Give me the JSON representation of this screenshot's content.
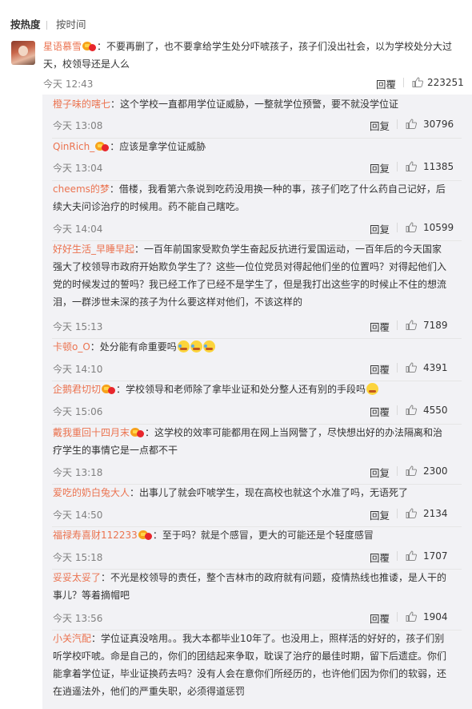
{
  "sort": {
    "hot_label": "按热度",
    "time_label": "按时间"
  },
  "top_comment": {
    "username": "星语慕雪",
    "text": "：不要再删了，也不要拿给学生处分吓唬孩子，孩子们没出社会，以为学校处分大过天，校领导还是人么",
    "time": "今天 12:43",
    "reply_label": "回覆",
    "likes": "223251"
  },
  "replies": [
    {
      "username": "橙子味的嗐七",
      "vip": false,
      "text": "：这个学校一直都用学位证威胁，一整就学位预警，要不就没学位证",
      "time": "今天 13:08",
      "reply_label": "回复",
      "likes": "30796"
    },
    {
      "username": "QinRich_",
      "vip": true,
      "text": "：应该是拿学位证威胁",
      "time": "今天 13:04",
      "reply_label": "回复",
      "likes": "11385"
    },
    {
      "username": "cheems的梦",
      "vip": false,
      "text": "：借楼，我看第六条说到吃药没用换一种的事，孩子们吃了什么药自己记好，后续大夫问诊治疗的时候用。药不能自己瞎吃。",
      "time": "今天 14:04",
      "reply_label": "回复",
      "likes": "10599"
    },
    {
      "username": "好好生活_早睡早起",
      "vip": false,
      "text": "：一百年前国家受欺负学生奋起反抗进行爱国运动，一百年后的今天国家强大了校领导市政府开始欺负学生了？这些一位位党员对得起他们坐的位置吗？对得起他们入党的时候发过的誓吗？我已经工作了已经不是学生了，但是我打出这些字的时候止不住的想流泪，一群涉世未深的孩子为什么要这样对他们，不该这样的",
      "time": "今天 15:13",
      "reply_label": "回覆",
      "likes": "7189"
    },
    {
      "username": "卡顿o_O",
      "vip": false,
      "text": "：处分能有命重要吗",
      "emojis": 3,
      "time": "今天 14:10",
      "reply_label": "回覆",
      "likes": "4391"
    },
    {
      "username": "企鹅君切切",
      "vip": true,
      "text": "：学校领导和老师除了拿毕业证和处分整人还有别的手段吗",
      "emojis": 1,
      "time": "今天 15:06",
      "reply_label": "回覆",
      "likes": "4550"
    },
    {
      "username": "戴我重回十四月末",
      "vip": true,
      "text": "：这学校的效率可能都用在网上当网警了，尽快想出好的办法隔离和治疗学生的事情它是一点都不干",
      "time": "今天 13:18",
      "reply_label": "回复",
      "likes": "2300"
    },
    {
      "username": "爱吃的奶白兔大人",
      "vip": false,
      "text": "：出事儿了就会吓唬学生，现在高校也就这个水准了吗，无语死了",
      "time": "今天 14:50",
      "reply_label": "回复",
      "likes": "2134"
    },
    {
      "username": "福禄寿喜财112233",
      "vip": true,
      "text": "：至于吗？就是个感冒，更大的可能还是个轻度感冒",
      "time": "今天 15:18",
      "reply_label": "回覆",
      "likes": "1707"
    },
    {
      "username": "妥妥太妥了",
      "vip": false,
      "text": "：不光是校领导的责任，整个吉林市的政府就有问题，疫情热线也推诿，是人干的事儿？等着摘帽吧",
      "time": "今天 13:56",
      "reply_label": "回覆",
      "likes": "1904"
    },
    {
      "username": "小关汽配",
      "vip": false,
      "text": "：学位证真没啥用。。我大本都毕业10年了。也没用上，照样活的好好的，孩子们别听学校吓唬。命是自己的，你们的团结起来争取，耽误了治疗的最佳时期，留下后遗症。你们能拿着学位证，毕业证换药去吗？没有人会在意你们所经历的，也许他们因为你们的软弱，还在逍遥法外，他们的严重失职，必须得道惩罚"
    }
  ]
}
